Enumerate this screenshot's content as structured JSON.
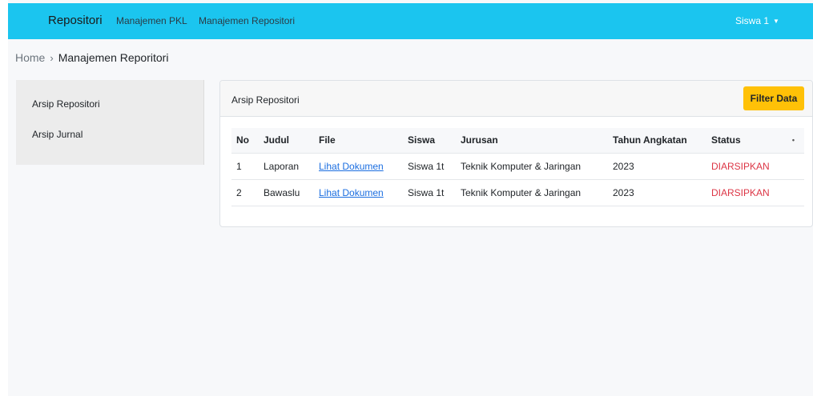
{
  "navbar": {
    "brand": "Repositori",
    "links": [
      "Manajemen PKL",
      "Manajemen Repositori"
    ],
    "user": "Siswa 1",
    "colors": {
      "background": "#1bc5ef",
      "user_text": "#ffffff"
    }
  },
  "breadcrumb": {
    "home": "Home",
    "separator": "›",
    "current": "Manajemen Reporitori"
  },
  "sidebar": {
    "items": [
      {
        "label": "Arsip Repositori"
      },
      {
        "label": "Arsip Jurnal"
      }
    ]
  },
  "card": {
    "title": "Arsip Repositori",
    "filter_button": "Filter Data",
    "filter_color": "#ffc107"
  },
  "table": {
    "headers": [
      "No",
      "Judul",
      "File",
      "Siswa",
      "Jurusan",
      "Tahun Angkatan",
      "Status",
      "•"
    ],
    "rows": [
      {
        "no": "1",
        "judul": "Laporan",
        "file": "Lihat Dokumen",
        "siswa": "Siswa 1t",
        "jurusan": "Teknik Komputer & Jaringan",
        "tahun": "2023",
        "status": "DIARSIPKAN"
      },
      {
        "no": "2",
        "judul": "Bawaslu",
        "file": "Lihat Dokumen",
        "siswa": "Siswa 1t",
        "jurusan": "Teknik Komputer & Jaringan",
        "tahun": "2023",
        "status": "DIARSIPKAN"
      }
    ],
    "status_color": "#dc3545",
    "link_color": "#1b6ee0"
  },
  "icons": {
    "caret": "caret-down-icon"
  }
}
